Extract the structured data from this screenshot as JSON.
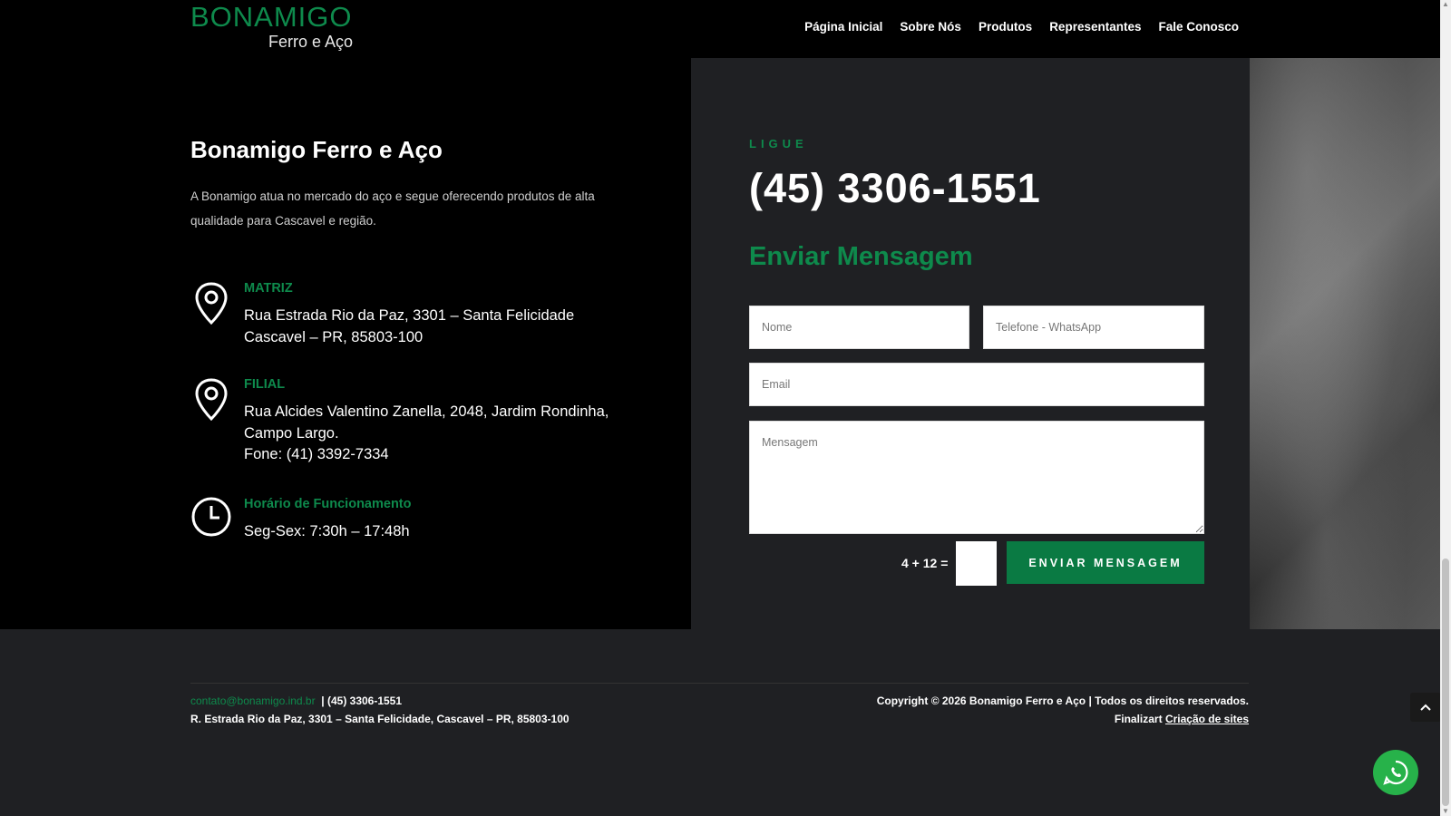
{
  "header": {
    "logo_main": "BONAMIGO",
    "logo_sub": "Ferro e Aço",
    "nav": [
      "Página Inicial",
      "Sobre Nós",
      "Produtos",
      "Representantes",
      "Fale Conosco"
    ]
  },
  "about": {
    "title": "Bonamigo Ferro e Aço",
    "description": "A Bonamigo atua no mercado do aço e segue oferecendo produtos de alta qualidade para Cascavel e região."
  },
  "locations": [
    {
      "label": "MATRIZ",
      "lines": [
        "Rua Estrada Rio da Paz, 3301 – Santa Felicidade",
        "Cascavel – PR, 85803-100"
      ],
      "icon": "map-pin-icon"
    },
    {
      "label": "FILIAL",
      "lines": [
        "Rua Alcides Valentino Zanella, 2048, Jardim Rondinha,",
        "Campo Largo.",
        "Fone: (41) 3392-7334"
      ],
      "icon": "map-pin-icon"
    }
  ],
  "hours": {
    "label": "Horário de Funcionamento",
    "text": "Seg-Sex: 7:30h – 17:48h",
    "icon": "clock-icon"
  },
  "contact": {
    "call_label": "LIGUE",
    "phone": "(45) 3306-1551",
    "form_title": "Enviar Mensagem",
    "placeholders": {
      "name": "Nome",
      "phone": "Telefone - WhatsApp",
      "email": "Email",
      "message": "Mensagem"
    },
    "captcha": "4 + 12 =",
    "submit": "ENVIAR MENSAGEM"
  },
  "footer": {
    "email": "contato@bonamigo.ind.br",
    "phone": "| (45) 3306-1551",
    "address": "R. Estrada Rio da Paz, 3301 – Santa Felicidade, Cascavel – PR, 85803-100",
    "copyright": "Copyright © 2026 Bonamigo Ferro e Aço | Todos os direitos reservados.",
    "credit_prefix": "Finalizart",
    "credit_link": "Criação de sites"
  },
  "colors": {
    "brand_green": "#0e8a4c",
    "button_green": "#0a7a43",
    "whatsapp_green": "#27b24a",
    "panel": "#1f2023"
  }
}
